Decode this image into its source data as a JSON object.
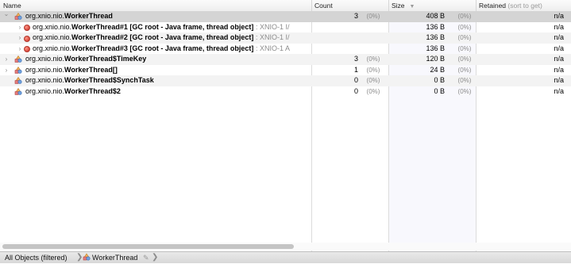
{
  "header": {
    "name": "Name",
    "count": "Count",
    "size": "Size",
    "retained": "Retained",
    "retained_hint": "(sort to get)"
  },
  "rows": [
    {
      "pkg": "org.xnio.nio.",
      "cls": "WorkerThread",
      "extra": "",
      "dim": "",
      "count": "3",
      "count_pct": "(0%)",
      "size": "408 B",
      "size_pct": "(0%)",
      "retained": "n/a",
      "toggle": "expanded",
      "kind": "class"
    },
    {
      "pkg": "org.xnio.nio.",
      "cls": "WorkerThread#1 [GC root - Java frame, thread object]",
      "extra": "",
      "dim": " : XNIO-1 I/",
      "count": "",
      "count_pct": "",
      "size": "136 B",
      "size_pct": "(0%)",
      "retained": "n/a",
      "toggle": "collapsed",
      "kind": "instance"
    },
    {
      "pkg": "org.xnio.nio.",
      "cls": "WorkerThread#2 [GC root - Java frame, thread object]",
      "extra": "",
      "dim": " : XNIO-1 I/",
      "count": "",
      "count_pct": "",
      "size": "136 B",
      "size_pct": "(0%)",
      "retained": "n/a",
      "toggle": "collapsed",
      "kind": "instance"
    },
    {
      "pkg": "org.xnio.nio.",
      "cls": "WorkerThread#3 [GC root - Java frame, thread object]",
      "extra": "",
      "dim": " : XNIO-1 A",
      "count": "",
      "count_pct": "",
      "size": "136 B",
      "size_pct": "(0%)",
      "retained": "n/a",
      "toggle": "collapsed",
      "kind": "instance"
    },
    {
      "pkg": "org.xnio.nio.",
      "cls": "WorkerThread$TimeKey",
      "extra": "",
      "dim": "",
      "count": "3",
      "count_pct": "(0%)",
      "size": "120 B",
      "size_pct": "(0%)",
      "retained": "n/a",
      "toggle": "collapsed",
      "kind": "class"
    },
    {
      "pkg": "org.xnio.nio.",
      "cls": "WorkerThread[]",
      "extra": "",
      "dim": "",
      "count": "1",
      "count_pct": "(0%)",
      "size": "24 B",
      "size_pct": "(0%)",
      "retained": "n/a",
      "toggle": "collapsed",
      "kind": "class"
    },
    {
      "pkg": "org.xnio.nio.",
      "cls": "WorkerThread$SynchTask",
      "extra": "",
      "dim": "",
      "count": "0",
      "count_pct": "(0%)",
      "size": "0 B",
      "size_pct": "(0%)",
      "retained": "n/a",
      "toggle": "none",
      "kind": "class"
    },
    {
      "pkg": "org.xnio.nio.",
      "cls": "WorkerThread$2",
      "extra": "",
      "dim": "",
      "count": "0",
      "count_pct": "(0%)",
      "size": "0 B",
      "size_pct": "(0%)",
      "retained": "n/a",
      "toggle": "none",
      "kind": "class"
    }
  ],
  "status": {
    "crumb1": "All Objects (filtered)",
    "crumb2": "WorkerThread",
    "pin_icon": "pin-icon",
    "sep_icon": "chevron-right-icon"
  },
  "icons": {
    "class": "class-icon",
    "instance": "instance-icon",
    "sort": "sort-descending-icon"
  },
  "colors": {
    "selected_row": "#d4d4d4",
    "instance_dot": "#d8463a"
  }
}
